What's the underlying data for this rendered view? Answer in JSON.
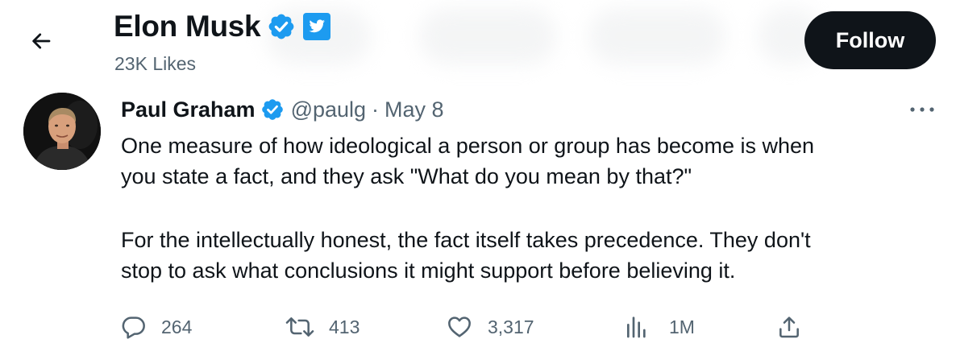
{
  "header": {
    "title": "Elon Musk",
    "subtitle": "23K Likes",
    "follow_label": "Follow"
  },
  "tweet": {
    "author_name": "Paul Graham",
    "handle": "@paulg",
    "separator": "·",
    "date": "May 8",
    "paragraphs": [
      [
        "One measure of how ideological a person or group has become is when",
        "you state a fact, and they ask \"What do you mean by that?\""
      ],
      [
        "For the intellectually honest, the fact itself takes precedence. They don't",
        "stop to ask what conclusions it might support before believing it."
      ]
    ],
    "actions": {
      "replies": "264",
      "retweets": "413",
      "likes": "3,317",
      "views": "1M"
    }
  },
  "icons": {
    "back": "arrow-left-icon",
    "verified": "verified-badge-icon",
    "twitter": "twitter-bird-icon",
    "more": "more-dots-icon",
    "reply": "reply-icon",
    "retweet": "retweet-icon",
    "like": "heart-icon",
    "views": "views-chart-icon",
    "share": "share-icon"
  },
  "colors": {
    "text": "#0f1419",
    "secondary": "#536471",
    "verified": "#1d9bf0",
    "button_bg": "#0f1419"
  }
}
